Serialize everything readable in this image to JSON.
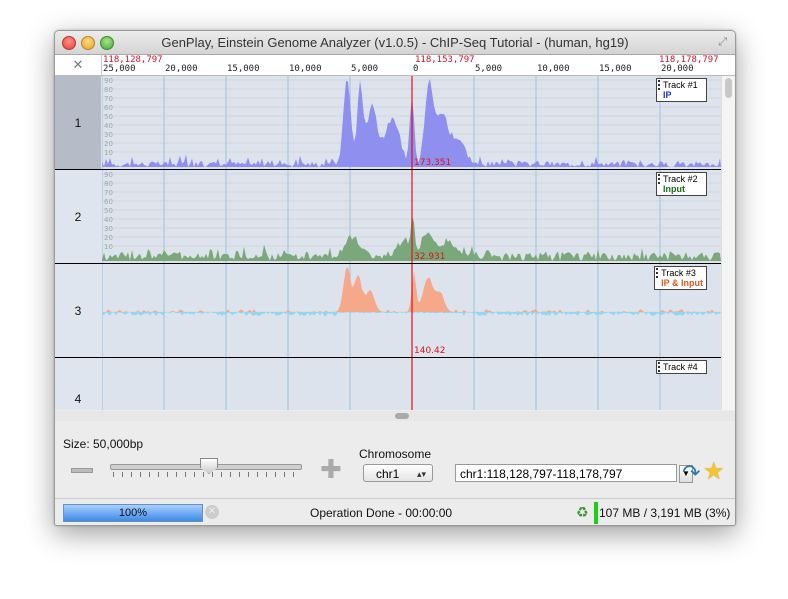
{
  "window": {
    "title": "GenPlay, Einstein Genome Analyzer (v1.0.5) - ChIP-Seq Tutorial - (human, hg19)"
  },
  "ruler": {
    "start_position": "118,128,797",
    "center_position": "118,153,797",
    "end_position": "118,178,797",
    "ticks": [
      "25,000",
      "20,000",
      "15,000",
      "10,000",
      "5,000",
      "0",
      "5,000",
      "10,000",
      "15,000",
      "20,000"
    ]
  },
  "tracks": [
    {
      "number": "1",
      "name": "Track #1",
      "type": "IP",
      "type_color": "#1a33d6",
      "fill": "#8f8ff0",
      "center_value": "173.351",
      "y_labels": [
        "90",
        "80",
        "70",
        "60",
        "50",
        "40",
        "30",
        "20",
        "10"
      ]
    },
    {
      "number": "2",
      "name": "Track #2",
      "type": "Input",
      "type_color": "#1a6e1a",
      "fill": "#7aa87a",
      "center_value": "32.931",
      "y_labels": [
        "90",
        "80",
        "70",
        "60",
        "50",
        "40",
        "30",
        "20",
        "10"
      ]
    },
    {
      "number": "3",
      "name": "Track #3",
      "type": "IP & Input",
      "type_color": "#e05a1a",
      "fill": "#f6a98a",
      "neg_fill": "#8fd8f0",
      "center_value": "140.42",
      "y_labels": []
    },
    {
      "number": "4",
      "name": "Track #4",
      "type": "",
      "type_color": "#000000",
      "center_value": "",
      "y_labels": []
    }
  ],
  "controls": {
    "size_label": "Size: 50,000bp",
    "zoom_fraction": 0.5,
    "chromosome_label": "Chromosome",
    "chromosome_value": "chr1",
    "position_value": "chr1:118,128,797-118,178,797"
  },
  "status": {
    "progress_text": "100%",
    "progress_fraction": 1.0,
    "operation_text": "Operation Done  -  00:00:00",
    "memory_text": "107 MB / 3,191 MB (3%)"
  },
  "colors": {
    "cursor_line": "#e0101a",
    "grid": "#9ec0e0",
    "ruler_red": "#d0102a"
  }
}
